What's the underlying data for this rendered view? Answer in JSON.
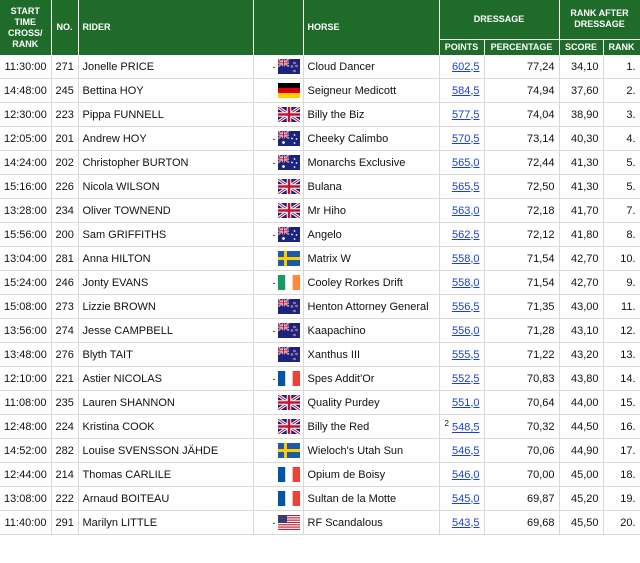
{
  "header": {
    "start_time": "START TIME CROSS/ RANK",
    "no": "NO.",
    "rider": "RIDER",
    "horse": "HORSE",
    "dressage": "DRESSAGE",
    "rank_after": "RANK AFTER DRESSAGE",
    "points": "POINTS",
    "percentage": "PERCENTAGE",
    "score": "SCORE",
    "rank": "RANK"
  },
  "rows": [
    {
      "time": "11:30:00",
      "no": "271",
      "rider": "Jonelle PRICE",
      "flag": "nz",
      "horse": "Cloud Dancer",
      "points": "602,5",
      "pct": "77,24",
      "score": "34,10",
      "rank": "1.",
      "mark": "-"
    },
    {
      "time": "14:48:00",
      "no": "245",
      "rider": "Bettina HOY",
      "flag": "de",
      "horse": "Seigneur Medicott",
      "points": "584,5",
      "pct": "74,94",
      "score": "37,60",
      "rank": "2.",
      "mark": ""
    },
    {
      "time": "12:30:00",
      "no": "223",
      "rider": "Pippa FUNNELL",
      "flag": "gb",
      "horse": "Billy the Biz",
      "points": "577,5",
      "pct": "74,04",
      "score": "38,90",
      "rank": "3.",
      "mark": ""
    },
    {
      "time": "12:05:00",
      "no": "201",
      "rider": "Andrew HOY",
      "flag": "au",
      "horse": "Cheeky Calimbo",
      "points": "570,5",
      "pct": "73,14",
      "score": "40,30",
      "rank": "4.",
      "mark": "-"
    },
    {
      "time": "14:24:00",
      "no": "202",
      "rider": "Christopher BURTON",
      "flag": "au",
      "horse": "Monarchs Exclusive",
      "points": "565,0",
      "pct": "72,44",
      "score": "41,30",
      "rank": "5.",
      "mark": "-"
    },
    {
      "time": "15:16:00",
      "no": "226",
      "rider": "Nicola WILSON",
      "flag": "gb",
      "horse": "Bulana",
      "points": "565,5",
      "pct": "72,50",
      "score": "41,30",
      "rank": "5.",
      "mark": ""
    },
    {
      "time": "13:28:00",
      "no": "234",
      "rider": "Oliver TOWNEND",
      "flag": "gb",
      "horse": "Mr Hiho",
      "points": "563,0",
      "pct": "72,18",
      "score": "41,70",
      "rank": "7.",
      "mark": ""
    },
    {
      "time": "15:56:00",
      "no": "200",
      "rider": "Sam GRIFFITHS",
      "flag": "au",
      "horse": "Angelo",
      "points": "562,5",
      "pct": "72,12",
      "score": "41,80",
      "rank": "8.",
      "mark": "-"
    },
    {
      "time": "13:04:00",
      "no": "281",
      "rider": "Anna HILTON",
      "flag": "se",
      "horse": "Matrix W",
      "points": "558,0",
      "pct": "71,54",
      "score": "42,70",
      "rank": "10.",
      "mark": ""
    },
    {
      "time": "15:24:00",
      "no": "246",
      "rider": "Jonty EVANS",
      "flag": "ie",
      "horse": "Cooley Rorkes Drift",
      "points": "558,0",
      "pct": "71,54",
      "score": "42,70",
      "rank": "9.",
      "mark": "-"
    },
    {
      "time": "15:08:00",
      "no": "273",
      "rider": "Lizzie BROWN",
      "flag": "nz",
      "horse": "Henton Attorney General",
      "points": "556,5",
      "pct": "71,35",
      "score": "43,00",
      "rank": "11.",
      "mark": "",
      "wrap": true
    },
    {
      "time": "13:56:00",
      "no": "274",
      "rider": "Jesse CAMPBELL",
      "flag": "nz",
      "horse": "Kaapachino",
      "points": "556,0",
      "pct": "71,28",
      "score": "43,10",
      "rank": "12.",
      "mark": "-"
    },
    {
      "time": "13:48:00",
      "no": "276",
      "rider": "Blyth TAIT",
      "flag": "nz",
      "horse": "Xanthus III",
      "points": "555,5",
      "pct": "71,22",
      "score": "43,20",
      "rank": "13.",
      "mark": ""
    },
    {
      "time": "12:10:00",
      "no": "221",
      "rider": "Astier NICOLAS",
      "flag": "fr",
      "horse": "Spes Addit'Or",
      "points": "552,5",
      "pct": "70,83",
      "score": "43,80",
      "rank": "14.",
      "mark": "-"
    },
    {
      "time": "11:08:00",
      "no": "235",
      "rider": "Lauren SHANNON",
      "flag": "gb",
      "horse": "Quality Purdey",
      "points": "551,0",
      "pct": "70,64",
      "score": "44,00",
      "rank": "15.",
      "mark": ""
    },
    {
      "time": "12:48:00",
      "no": "224",
      "rider": "Kristina COOK",
      "flag": "gb",
      "horse": "Billy the Red",
      "points": "548,5",
      "pct": "70,32",
      "score": "44,50",
      "rank": "16.",
      "mark": "",
      "sup": "2"
    },
    {
      "time": "14:52:00",
      "no": "282",
      "rider": "Louise SVENSSON JÄHDE",
      "flag": "se",
      "horse": "Wieloch's Utah Sun",
      "points": "546,5",
      "pct": "70,06",
      "score": "44,90",
      "rank": "17.",
      "mark": ""
    },
    {
      "time": "12:44:00",
      "no": "214",
      "rider": "Thomas CARLILE",
      "flag": "fr",
      "horse": "Opium de Boisy",
      "points": "546,0",
      "pct": "70,00",
      "score": "45,00",
      "rank": "18.",
      "mark": ""
    },
    {
      "time": "13:08:00",
      "no": "222",
      "rider": "Arnaud BOITEAU",
      "flag": "fr",
      "horse": "Sultan de la Motte",
      "points": "545,0",
      "pct": "69,87",
      "score": "45,20",
      "rank": "19.",
      "mark": ""
    },
    {
      "time": "11:40:00",
      "no": "291",
      "rider": "Marilyn LITTLE",
      "flag": "us",
      "horse": "RF Scandalous",
      "points": "543,5",
      "pct": "69,68",
      "score": "45,50",
      "rank": "20.",
      "mark": "-"
    }
  ]
}
